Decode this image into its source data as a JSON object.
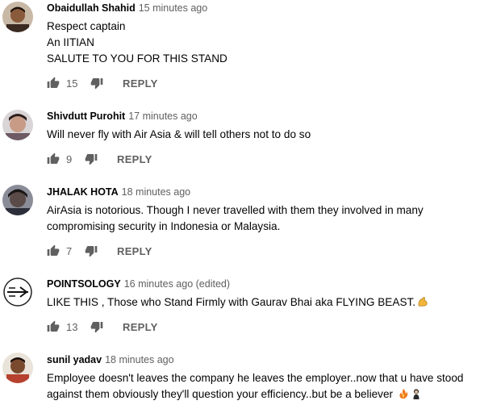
{
  "comments": [
    {
      "author": "Obaidullah Shahid",
      "time": "15 minutes ago",
      "lines": [
        "Respect captain",
        "An IITIAN",
        "SALUTE TO YOU FOR THIS STAND"
      ],
      "likes": "15",
      "reply": "REPLY"
    },
    {
      "author": "Shivdutt Purohit",
      "time": "17 minutes ago",
      "lines": [
        "Will never fly with Air Asia & will tell others not to do so"
      ],
      "likes": "9",
      "reply": "REPLY"
    },
    {
      "author": "JHALAK HOTA",
      "time": "18 minutes ago",
      "lines": [
        "AirAsia is notorious. Though I never travelled with them they involved in many",
        "compromising security in Indonesia or Malaysia."
      ],
      "likes": "7",
      "reply": "REPLY"
    },
    {
      "author": "POINTSOLOGY",
      "time": "16 minutes ago (edited)",
      "lines": [
        "LIKE THIS , Those who Stand Firmly with Gaurav Bhai aka FLYING BEAST."
      ],
      "likes": "13",
      "reply": "REPLY"
    },
    {
      "author": "sunil yadav",
      "time": "18 minutes ago",
      "lines": [
        "Employee doesn't leaves the company he leaves the employer..now that u have stood",
        "against them obviously they'll question your efficiency..but be a believer"
      ],
      "likes": "",
      "reply": "REPLY"
    }
  ],
  "icons": {
    "like": "thumbs-up-icon",
    "dislike": "thumbs-down-icon"
  },
  "colors": {
    "author": "#030303",
    "meta": "#606060",
    "text": "#030303"
  }
}
